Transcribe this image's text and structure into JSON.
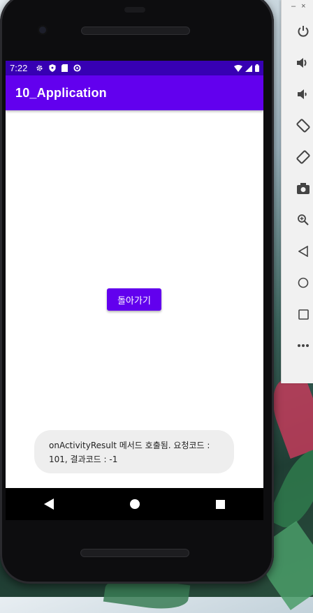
{
  "status_bar": {
    "time": "7:22"
  },
  "app_bar": {
    "title": "10_Application"
  },
  "main": {
    "back_button_label": "돌아가기"
  },
  "toast": {
    "message": "onActivityResult 메서드 호출됨. 요청코드 : 101, 결과코드 : -1"
  },
  "nav_bar": {
    "icons": [
      "back-icon",
      "home-icon",
      "recents-icon"
    ]
  },
  "emulator_panel": {
    "window_controls": [
      "–",
      "×"
    ],
    "tools": [
      "power-icon",
      "volume-up-icon",
      "volume-down-icon",
      "rotate-left-icon",
      "rotate-right-icon",
      "camera-icon",
      "zoom-icon",
      "back-icon",
      "home-icon",
      "overview-icon",
      "more-icon"
    ]
  },
  "colors": {
    "primary": "#6200ee",
    "primary_dark": "#3700b3",
    "toast_bg": "#eeeeee"
  }
}
